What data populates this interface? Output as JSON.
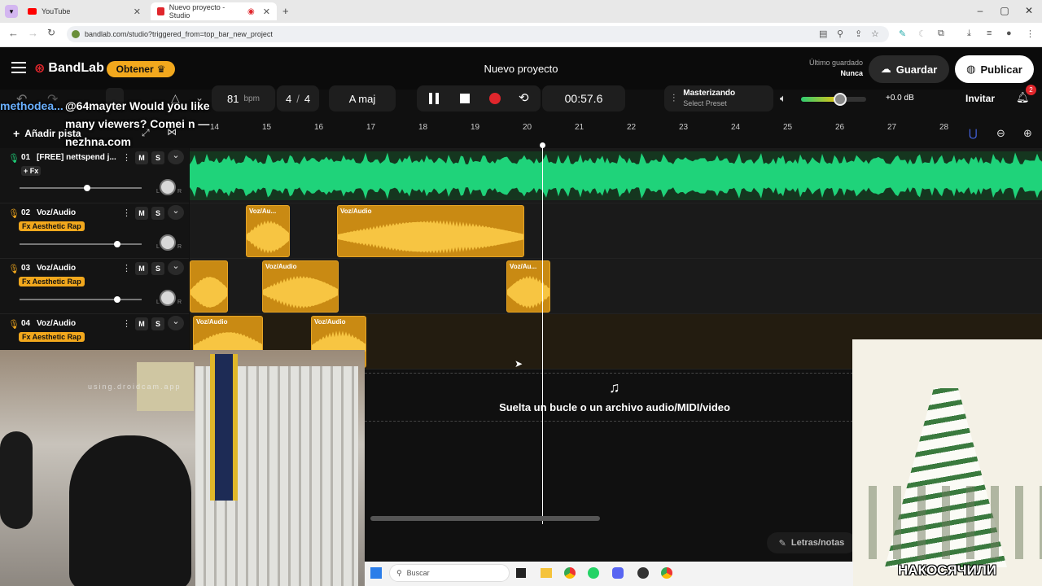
{
  "browser": {
    "tabs": [
      {
        "label": "YouTube"
      },
      {
        "label": "Nuevo proyecto - Studio"
      }
    ],
    "url": "bandlab.com/studio?triggered_from=top_bar_new_project"
  },
  "app": {
    "logo": "BandLab",
    "obtener": "Obtener",
    "project_title": "Nuevo proyecto",
    "last_saved_label": "Último guardado",
    "last_saved_value": "Nunca",
    "save": "Guardar",
    "publish": "Publicar"
  },
  "toolbar": {
    "bpm": "81",
    "bpm_unit": "bpm",
    "time_sig_num": "4",
    "time_sig_sep": "/",
    "time_sig_den": "4",
    "key": "A maj",
    "time": "00:57.6",
    "mastering_title": "Masterizando",
    "mastering_preset": "Select Preset",
    "volume_db": "+0.0 dB",
    "volume_level": 0.6,
    "invite": "Invitar",
    "notif_count": "2",
    "add_track": "Añadir pista"
  },
  "ruler": [
    "14",
    "15",
    "16",
    "17",
    "18",
    "19",
    "20",
    "21",
    "22",
    "23",
    "24",
    "25",
    "26",
    "27",
    "28"
  ],
  "tracks": [
    {
      "num": "01",
      "name": "[FREE] nettspend j...",
      "fx": "+ Fx",
      "vol": 0.55
    },
    {
      "num": "02",
      "name": "Voz/Audio",
      "fx": "Fx Aesthetic Rap",
      "vol": 0.8
    },
    {
      "num": "03",
      "name": "Voz/Audio",
      "fx": "Fx Aesthetic Rap",
      "vol": 0.8
    },
    {
      "num": "04",
      "name": "Voz/Audio",
      "fx": "Fx Aesthetic Rap",
      "vol": 0.8
    }
  ],
  "track_btns": {
    "m": "M",
    "s": "S",
    "l": "L",
    "r": "R"
  },
  "clip_label": "Voz/Au...",
  "clip_label_full": "Voz/Audio",
  "drop_text": "Suelta un bucle o un archivo audio/MIDI/video",
  "lyrics": "Letras/notas",
  "overlay_chat": {
    "user": "methodea...",
    "line1": "@64mayter Would you like",
    "line2": "many viewers? Comei n —",
    "line3": "nezhna.com"
  },
  "webcam_text": "using.droidcam.app",
  "poster_caption": "НАКОСЯЧИЛИ",
  "taskbar": {
    "search": "Buscar"
  },
  "colors": {
    "accent": "#f2a81d",
    "waveform": "#1fd37a",
    "clip": "#c98a13"
  }
}
